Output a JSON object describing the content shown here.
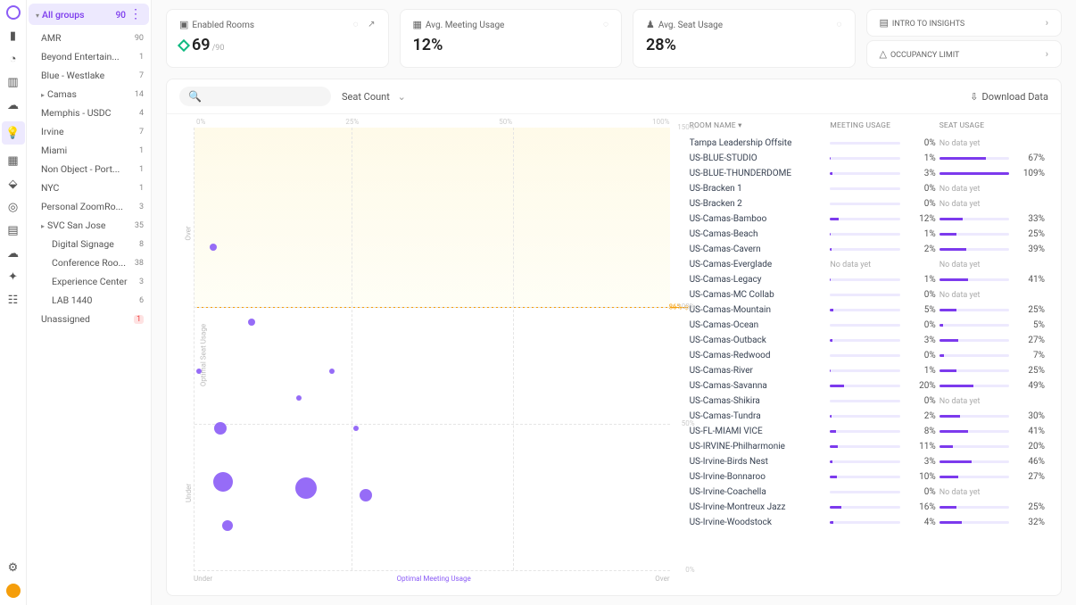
{
  "sidebar": {
    "all_label": "All groups",
    "all_count": "90",
    "items": [
      {
        "label": "AMR",
        "count": "90",
        "expanded": true,
        "indent": 0
      },
      {
        "label": "Beyond Entertain...",
        "count": "1",
        "indent": 0
      },
      {
        "label": "Blue - Westlake",
        "count": "7",
        "indent": 0
      },
      {
        "label": "Camas",
        "count": "14",
        "expanded": true,
        "indent": 0,
        "tri": true
      },
      {
        "label": "Memphis - USDC",
        "count": "4",
        "indent": 0
      },
      {
        "label": "Irvine",
        "count": "7",
        "indent": 0
      },
      {
        "label": "Miami",
        "count": "1",
        "indent": 0
      },
      {
        "label": "Non Object - Port...",
        "count": "1",
        "indent": 0
      },
      {
        "label": "NYC",
        "count": "1",
        "indent": 0
      },
      {
        "label": "Personal ZoomRo...",
        "count": "3",
        "indent": 0
      },
      {
        "label": "SVC San Jose",
        "count": "35",
        "expanded": true,
        "indent": 0,
        "tri": true
      },
      {
        "label": "Digital Signage",
        "count": "8",
        "indent": 1
      },
      {
        "label": "Conference Roo...",
        "count": "38",
        "indent": 1
      },
      {
        "label": "Experience Center",
        "count": "3",
        "indent": 1
      },
      {
        "label": "LAB 1440",
        "count": "6",
        "indent": 1
      },
      {
        "label": "Unassigned",
        "count": "1",
        "indent": 0,
        "red": true
      }
    ]
  },
  "cards": {
    "enabled_label": "Enabled Rooms",
    "enabled_value": "69",
    "enabled_total": "/90",
    "avg_meeting_label": "Avg. Meeting Usage",
    "avg_meeting_value": "12%",
    "avg_seat_label": "Avg. Seat Usage",
    "avg_seat_value": "28%",
    "intro": "INTRO TO INSIGHTS",
    "occupancy": "OCCUPANCY LIMIT"
  },
  "panel": {
    "seat_count": "Seat Count",
    "download": "Download Data"
  },
  "chart_data": {
    "type": "scatter",
    "xlabel": "Optimal Meeting Usage",
    "ylabel": "Optimal Seat Usage",
    "x_under": "Under",
    "x_over": "Over",
    "y_over": "Over",
    "y_under": "Under",
    "x_ticks": [
      "0%",
      "25%",
      "50%",
      "100%"
    ],
    "y_ticks": [
      {
        "label": "150%",
        "pos": 0
      },
      {
        "label": "100%",
        "pos": 40.5
      },
      {
        "label": "50%",
        "pos": 67
      },
      {
        "label": "0%",
        "pos": 100
      }
    ],
    "occupancy_limit_label": "86% ◇",
    "occupancy_limit_pct": 40.5,
    "bubbles": [
      {
        "x": 4,
        "y": 27,
        "r": 4
      },
      {
        "x": 12,
        "y": 44,
        "r": 4
      },
      {
        "x": 1,
        "y": 55,
        "r": 3
      },
      {
        "x": 29,
        "y": 55,
        "r": 3
      },
      {
        "x": 22,
        "y": 61,
        "r": 3
      },
      {
        "x": 5.5,
        "y": 68,
        "r": 7
      },
      {
        "x": 34,
        "y": 68,
        "r": 3
      },
      {
        "x": 6,
        "y": 80,
        "r": 11
      },
      {
        "x": 23.5,
        "y": 81.5,
        "r": 12
      },
      {
        "x": 36,
        "y": 83,
        "r": 7
      },
      {
        "x": 7,
        "y": 90,
        "r": 6
      }
    ]
  },
  "table": {
    "head_room": "ROOM NAME",
    "head_mu": "MEETING USAGE",
    "head_su": "SEAT USAGE",
    "rows": [
      {
        "name": "Tampa Leadership Offsite",
        "mu": 0,
        "su": null
      },
      {
        "name": "US-BLUE-STUDIO",
        "mu": 1,
        "su": 67
      },
      {
        "name": "US-BLUE-THUNDERDOME",
        "mu": 3,
        "su": 109
      },
      {
        "name": "US-Bracken 1",
        "mu": 0,
        "su": null
      },
      {
        "name": "US-Bracken 2",
        "mu": 0,
        "su": null
      },
      {
        "name": "US-Camas-Bamboo",
        "mu": 12,
        "su": 33
      },
      {
        "name": "US-Camas-Beach",
        "mu": 1,
        "su": 25
      },
      {
        "name": "US-Camas-Cavern",
        "mu": 2,
        "su": 39
      },
      {
        "name": "US-Camas-Everglade",
        "mu": null,
        "su": null
      },
      {
        "name": "US-Camas-Legacy",
        "mu": 1,
        "su": 41
      },
      {
        "name": "US-Camas-MC Collab",
        "mu": 0,
        "su": null
      },
      {
        "name": "US-Camas-Mountain",
        "mu": 5,
        "su": 25
      },
      {
        "name": "US-Camas-Ocean",
        "mu": 0,
        "su": 5
      },
      {
        "name": "US-Camas-Outback",
        "mu": 3,
        "su": 27
      },
      {
        "name": "US-Camas-Redwood",
        "mu": 0,
        "su": 7
      },
      {
        "name": "US-Camas-River",
        "mu": 1,
        "su": 25
      },
      {
        "name": "US-Camas-Savanna",
        "mu": 20,
        "su": 49
      },
      {
        "name": "US-Camas-Shikira",
        "mu": 0,
        "su": null
      },
      {
        "name": "US-Camas-Tundra",
        "mu": 2,
        "su": 30
      },
      {
        "name": "US-FL-MIAMI VICE",
        "mu": 8,
        "su": 41
      },
      {
        "name": "US-IRVINE-Philharmonie",
        "mu": 11,
        "su": 20
      },
      {
        "name": "US-Irvine-Birds Nest",
        "mu": 3,
        "su": 46
      },
      {
        "name": "US-Irvine-Bonnaroo",
        "mu": 10,
        "su": 27
      },
      {
        "name": "US-Irvine-Coachella",
        "mu": 0,
        "su": null
      },
      {
        "name": "US-Irvine-Montreux Jazz",
        "mu": 16,
        "su": 25
      },
      {
        "name": "US-Irvine-Woodstock",
        "mu": 4,
        "su": 32
      }
    ],
    "no_data": "No data yet"
  }
}
